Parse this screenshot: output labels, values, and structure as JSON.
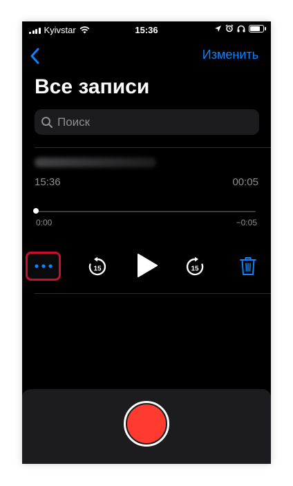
{
  "status_bar": {
    "carrier": "Kyivstar",
    "time": "15:36",
    "battery_level": 0.85
  },
  "nav": {
    "edit_label": "Изменить"
  },
  "title": "Все записи",
  "search": {
    "placeholder": "Поиск"
  },
  "recording": {
    "time": "15:36",
    "duration": "00:05",
    "elapsed": "0:00",
    "remaining": "−0:05",
    "skip_back_seconds": "15",
    "skip_forward_seconds": "15"
  },
  "colors": {
    "accent": "#0a84ff",
    "record": "#ff3b30",
    "highlight": "#c8102e",
    "background": "#000000"
  },
  "icons": [
    "back-chevron-icon",
    "search-icon",
    "more-icon",
    "skip-back-15-icon",
    "play-icon",
    "skip-forward-15-icon",
    "trash-icon",
    "record-icon"
  ]
}
